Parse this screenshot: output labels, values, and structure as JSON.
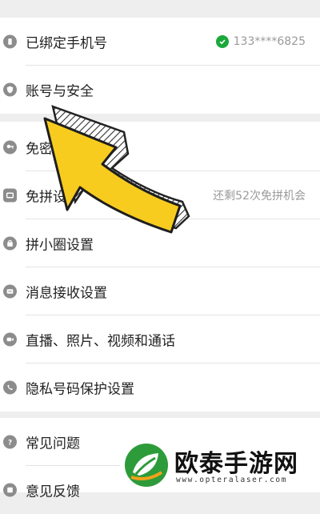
{
  "settings": {
    "groups": [
      {
        "items": [
          {
            "icon": "phone-icon",
            "label": "已绑定手机号",
            "value": "133****6825",
            "verified": true
          },
          {
            "icon": "shield-icon",
            "label": "账号与安全"
          }
        ]
      },
      {
        "items": [
          {
            "icon": "key-icon",
            "label": "免密"
          },
          {
            "icon": "card-icon",
            "label": "免拼设",
            "value": "还剩52次免拼机会"
          },
          {
            "icon": "bag-icon",
            "label": "拼小圈设置"
          },
          {
            "icon": "message-icon",
            "label": "消息接收设置"
          },
          {
            "icon": "video-icon",
            "label": "直播、照片、视频和通话"
          },
          {
            "icon": "privacy-icon",
            "label": "隐私号码保护设置"
          }
        ]
      },
      {
        "items": [
          {
            "icon": "help-icon",
            "label": "常见问题"
          },
          {
            "icon": "feedback-icon",
            "label": "意见反馈"
          }
        ]
      }
    ]
  },
  "overlay": {
    "arrow_color": "#f7cc1f"
  },
  "watermark": {
    "brand": "欧泰手游网",
    "url": "www.opteralaser.com",
    "brand_color": "#2e9b3a"
  }
}
